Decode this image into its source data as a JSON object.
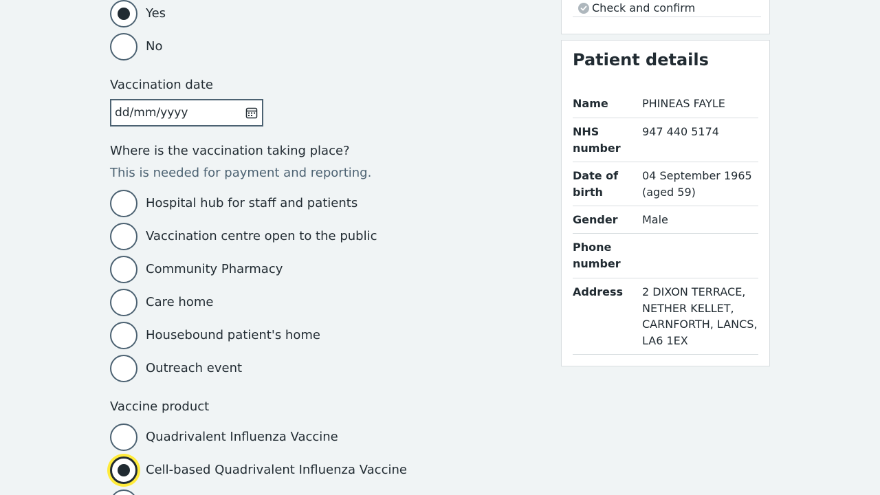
{
  "previous_question": {
    "options": [
      {
        "label": "Yes",
        "checked": true
      },
      {
        "label": "No",
        "checked": false
      }
    ]
  },
  "vaccination_date": {
    "label": "Vaccination date",
    "value": "dd/mm/yyyy"
  },
  "location": {
    "label": "Where is the vaccination taking place?",
    "hint": "This is needed for payment and reporting.",
    "options": [
      {
        "label": "Hospital hub for staff and patients",
        "checked": false
      },
      {
        "label": "Vaccination centre open to the public",
        "checked": false
      },
      {
        "label": "Community Pharmacy",
        "checked": false
      },
      {
        "label": "Care home",
        "checked": false
      },
      {
        "label": "Housebound patient's home",
        "checked": false
      },
      {
        "label": "Outreach event",
        "checked": false
      }
    ]
  },
  "vaccine_product": {
    "label": "Vaccine product",
    "options": [
      {
        "label": "Quadrivalent Influenza Vaccine",
        "checked": false
      },
      {
        "label": "Cell-based Quadrivalent Influenza Vaccine",
        "checked": true,
        "focused": true
      }
    ]
  },
  "steps": {
    "check_and_confirm": "Check and confirm"
  },
  "patient": {
    "title": "Patient details",
    "rows": [
      {
        "key": "Name",
        "value": "PHINEAS FAYLE"
      },
      {
        "key": "NHS number",
        "value": "947 440 5174"
      },
      {
        "key": "Date of birth",
        "value": "04 September 1965 (aged 59)"
      },
      {
        "key": "Gender",
        "value": "Male"
      },
      {
        "key": "Phone number",
        "value": ""
      },
      {
        "key": "Address",
        "value": "2 DIXON TERRACE, NETHER KELLET, CARNFORTH, LANCS, LA6 1EX"
      }
    ]
  },
  "colors": {
    "background": "#f0f4f5",
    "text": "#212b32",
    "secondary_text": "#4c6272",
    "focus": "#ffeb3b",
    "border": "#d8dde0"
  }
}
